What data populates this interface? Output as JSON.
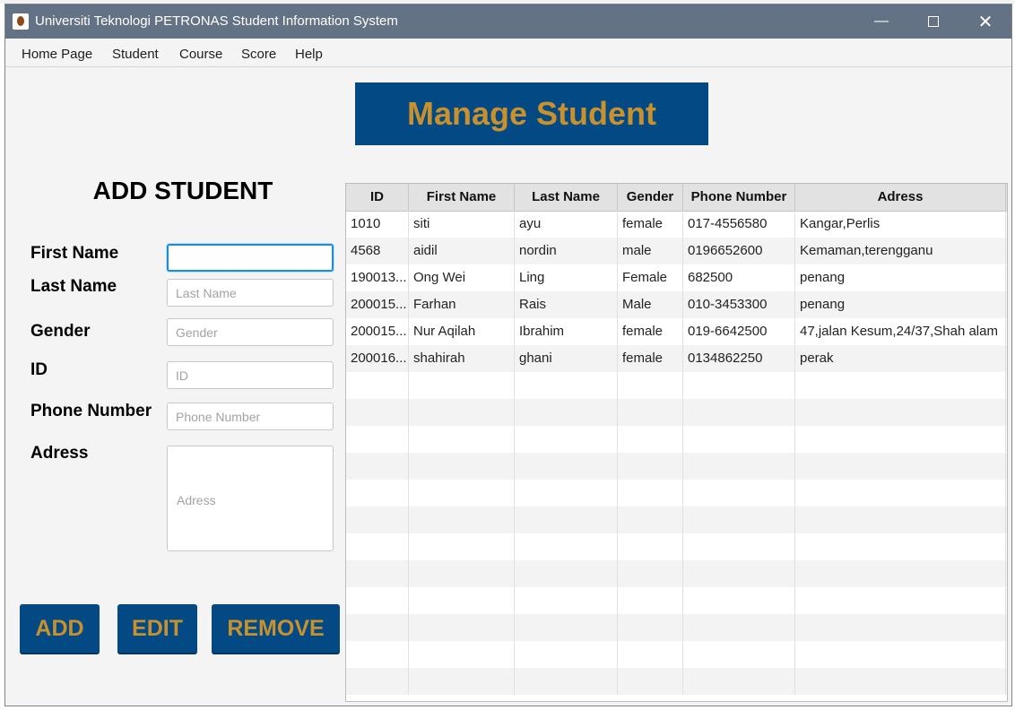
{
  "window": {
    "title": "Universiti Teknologi PETRONAS Student Information System"
  },
  "menu": [
    "Home Page",
    "Student",
    "Course",
    "Score",
    "Help"
  ],
  "banner": "Manage Student",
  "form": {
    "title": "ADD STUDENT",
    "fields": [
      {
        "label": "First Name",
        "value": "",
        "placeholder": ""
      },
      {
        "label": "Last Name",
        "value": "",
        "placeholder": "Last Name"
      },
      {
        "label": "Gender",
        "value": "",
        "placeholder": "Gender"
      },
      {
        "label": "ID",
        "value": "",
        "placeholder": "ID"
      },
      {
        "label": "Phone Number",
        "value": "",
        "placeholder": "Phone Number"
      },
      {
        "label": "Adress",
        "value": "",
        "placeholder": "Adress"
      }
    ],
    "buttons": {
      "add": "ADD",
      "edit": "EDIT",
      "remove": "REMOVE"
    }
  },
  "table": {
    "columns": [
      "ID",
      "First Name",
      "Last Name",
      "Gender",
      "Phone Number",
      "Adress"
    ],
    "rows": [
      [
        "1010",
        "siti",
        "ayu",
        "female",
        "017-4556580",
        "Kangar,Perlis"
      ],
      [
        "4568",
        "aidil",
        "nordin",
        "male",
        "0196652600",
        "Kemaman,terengganu"
      ],
      [
        "190013...",
        "Ong Wei",
        "Ling",
        "Female",
        "682500",
        "penang"
      ],
      [
        "200015...",
        "Farhan",
        "Rais",
        "Male",
        "010-3453300",
        "penang"
      ],
      [
        "200015...",
        "Nur Aqilah",
        "Ibrahim",
        "female",
        "019-6642500",
        "47,jalan Kesum,24/37,Shah alam"
      ],
      [
        "200016...",
        "shahirah",
        "ghani",
        "female",
        "0134862250",
        "perak"
      ]
    ]
  },
  "colors": {
    "titlebar": "#637284",
    "brand_blue": "#034a85",
    "brand_gold": "#c8912d",
    "focus": "#1a8fd6"
  }
}
